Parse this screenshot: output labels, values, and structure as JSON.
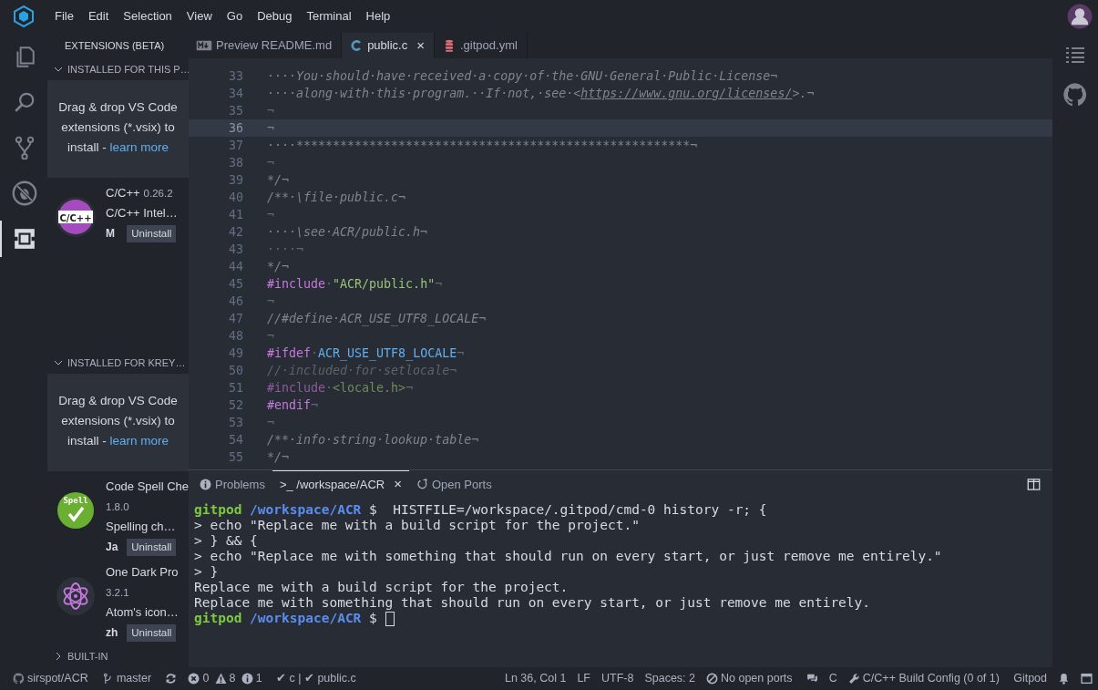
{
  "menu_bar": {
    "items": [
      "File",
      "Edit",
      "Selection",
      "View",
      "Go",
      "Debug",
      "Terminal",
      "Help"
    ]
  },
  "activity_bar": {
    "items": [
      {
        "kind": "files",
        "selected": false
      },
      {
        "kind": "search",
        "selected": false
      },
      {
        "kind": "scm",
        "selected": false
      },
      {
        "kind": "debug",
        "selected": false
      },
      {
        "kind": "extensions",
        "selected": true
      }
    ]
  },
  "sidebar": {
    "title": "EXTENSIONS (BETA)",
    "sections": [
      {
        "title": "INSTALLED FOR THIS P…",
        "expanded": true,
        "hint": {
          "text": "Drag & drop VS Code extensions (*.vsix) to install - ",
          "link": "learn more"
        },
        "extensions": [
          {
            "kind": "cpp",
            "icon_text": "C/C++",
            "name": "C/C++",
            "version": "0.26.2",
            "description": "C/C++ Intel…",
            "author": "M",
            "button": "Uninstall"
          }
        ]
      },
      {
        "title": "INSTALLED FOR KREY…",
        "expanded": true,
        "hint": {
          "text": "Drag & drop VS Code extensions (*.vsix) to install - ",
          "link": "learn more"
        },
        "extensions": [
          {
            "kind": "spell",
            "icon_text": "Spell",
            "name": "Code Spell Che",
            "version": "1.8.0",
            "description": "Spelling ch…",
            "author": "Ja",
            "button": "Uninstall"
          },
          {
            "kind": "atom",
            "name": "One Dark Pro",
            "version": "3.2.1",
            "description": "Atom's icon…",
            "author": "zh",
            "button": "Uninstall"
          }
        ]
      },
      {
        "title": "BUILT-IN",
        "expanded": false
      }
    ]
  },
  "editor_tabs": [
    {
      "kind": "markdown",
      "label": "Preview README.md",
      "selected": false
    },
    {
      "kind": "c",
      "label": "public.c",
      "selected": true,
      "close": "×"
    },
    {
      "kind": "yaml",
      "label": ".gitpod.yml",
      "selected": false
    }
  ],
  "editor": {
    "lines": [
      {
        "number": "33",
        "current": false,
        "tokens": [
          {
            "kind": "comment",
            "text": "····You·should·have·received·a·copy·of·the·GNU·General·Public·License¬"
          }
        ]
      },
      {
        "number": "34",
        "current": false,
        "tokens": [
          {
            "kind": "comment",
            "text": "····along·with·this·program.··If·not,·see·<"
          },
          {
            "kind": "link",
            "text": "https://www.gnu.org/licenses/"
          },
          {
            "kind": "comment",
            "text": ">.¬"
          }
        ]
      },
      {
        "number": "35",
        "current": false,
        "tokens": [
          {
            "kind": "ws",
            "text": "¬"
          }
        ]
      },
      {
        "number": "36",
        "current": true,
        "tokens": [
          {
            "kind": "ws",
            "text": "¬"
          }
        ]
      },
      {
        "number": "37",
        "current": false,
        "tokens": [
          {
            "kind": "comment",
            "text": "····******************************************************¬"
          }
        ]
      },
      {
        "number": "38",
        "current": false,
        "tokens": [
          {
            "kind": "ws",
            "text": "¬"
          }
        ]
      },
      {
        "number": "39",
        "current": false,
        "tokens": [
          {
            "kind": "comment",
            "text": "*/¬"
          }
        ]
      },
      {
        "number": "40",
        "current": false,
        "tokens": [
          {
            "kind": "comment",
            "text": "/**·\\file·public.c¬"
          }
        ]
      },
      {
        "number": "41",
        "current": false,
        "tokens": [
          {
            "kind": "ws",
            "text": "¬"
          }
        ]
      },
      {
        "number": "42",
        "current": false,
        "tokens": [
          {
            "kind": "comment",
            "text": "····\\see·ACR/public.h¬"
          }
        ]
      },
      {
        "number": "43",
        "current": false,
        "tokens": [
          {
            "kind": "ws",
            "text": "····¬"
          }
        ]
      },
      {
        "number": "44",
        "current": false,
        "tokens": [
          {
            "kind": "comment",
            "text": "*/¬"
          }
        ]
      },
      {
        "number": "45",
        "current": false,
        "tokens": [
          {
            "kind": "macro",
            "text": "#include"
          },
          {
            "kind": "ws",
            "text": "·"
          },
          {
            "kind": "string",
            "text": "\"ACR/public.h\""
          },
          {
            "kind": "ws",
            "text": "¬"
          }
        ]
      },
      {
        "number": "46",
        "current": false,
        "tokens": [
          {
            "kind": "ws",
            "text": "¬"
          }
        ]
      },
      {
        "number": "47",
        "current": false,
        "tokens": [
          {
            "kind": "comment",
            "text": "//#define·ACR_USE_UTF8_LOCALE¬"
          }
        ]
      },
      {
        "number": "48",
        "current": false,
        "tokens": [
          {
            "kind": "ws",
            "text": "¬"
          }
        ]
      },
      {
        "number": "49",
        "current": false,
        "tokens": [
          {
            "kind": "macro",
            "text": "#ifdef"
          },
          {
            "kind": "ws",
            "text": "·"
          },
          {
            "kind": "ident",
            "text": "ACR_USE_UTF8_LOCALE"
          },
          {
            "kind": "ws",
            "text": "¬"
          }
        ]
      },
      {
        "number": "50",
        "current": false,
        "tokens": [
          {
            "kind": "comment-inactive",
            "text": "//·included·for·setlocale¬"
          }
        ]
      },
      {
        "number": "51",
        "current": false,
        "tokens": [
          {
            "kind": "macro-inactive",
            "text": "#include"
          },
          {
            "kind": "ws",
            "text": "·"
          },
          {
            "kind": "string-inactive",
            "text": "<locale.h>"
          },
          {
            "kind": "ws",
            "text": "¬"
          }
        ]
      },
      {
        "number": "52",
        "current": false,
        "tokens": [
          {
            "kind": "macro",
            "text": "#endif"
          },
          {
            "kind": "ws",
            "text": "¬"
          }
        ]
      },
      {
        "number": "53",
        "current": false,
        "tokens": [
          {
            "kind": "ws",
            "text": "¬"
          }
        ]
      },
      {
        "number": "54",
        "current": false,
        "tokens": [
          {
            "kind": "comment",
            "text": "/**·info·string·lookup·table¬"
          }
        ]
      },
      {
        "number": "55",
        "current": false,
        "tokens": [
          {
            "kind": "comment",
            "text": "*/¬"
          }
        ]
      }
    ]
  },
  "panel": {
    "tabs": [
      {
        "kind": "info",
        "label": "Problems",
        "selected": false
      },
      {
        "kind": "terminal",
        "label": ">_ /workspace/ACR",
        "selected": true,
        "close": "×"
      },
      {
        "kind": "ports",
        "label": "Open Ports",
        "selected": false
      }
    ],
    "terminal": {
      "cursor": true,
      "lines": [
        {
          "segments": [
            {
              "kind": "user",
              "text": "gitpod"
            },
            {
              "kind": "path",
              "text": " /workspace/ACR"
            },
            {
              "kind": "plain",
              "text": " $  HISTFILE=/workspace/.gitpod/cmd-0 history -r; {"
            }
          ]
        },
        {
          "segments": [
            {
              "kind": "plain",
              "text": "> echo \"Replace me with a build script for the project.\""
            }
          ]
        },
        {
          "segments": [
            {
              "kind": "plain",
              "text": "> } && {"
            }
          ]
        },
        {
          "segments": [
            {
              "kind": "plain",
              "text": "> echo \"Replace me with something that should run on every start, or just remove me entirely.\""
            }
          ]
        },
        {
          "segments": [
            {
              "kind": "plain",
              "text": "> }"
            }
          ]
        },
        {
          "segments": [
            {
              "kind": "plain",
              "text": "Replace me with a build script for the project."
            }
          ]
        },
        {
          "segments": [
            {
              "kind": "plain",
              "text": "Replace me with something that should run on every start, or just remove me entirely."
            }
          ]
        },
        {
          "segments": [
            {
              "kind": "user",
              "text": "gitpod"
            },
            {
              "kind": "path",
              "text": " /workspace/ACR"
            },
            {
              "kind": "plain",
              "text": " $ "
            }
          ]
        }
      ]
    }
  },
  "status_bar": {
    "left": [
      {
        "parts": [
          {
            "kind": "github",
            "text": "sirspot/ACR"
          }
        ]
      },
      {
        "parts": [
          {
            "kind": "branch",
            "text": "master"
          }
        ]
      },
      {
        "parts": [
          {
            "kind": "sync"
          }
        ]
      },
      {
        "parts": [
          {
            "kind": "error",
            "text": "0"
          },
          {
            "kind": "warning",
            "text": "8"
          },
          {
            "kind": "info",
            "text": "1"
          }
        ]
      },
      {
        "parts": [
          {
            "text": "✔ c | ✔ public.c"
          }
        ]
      }
    ],
    "right": [
      {
        "parts": [
          {
            "text": "Ln 36, Col 1"
          }
        ]
      },
      {
        "parts": [
          {
            "text": "LF"
          }
        ]
      },
      {
        "parts": [
          {
            "text": "UTF-8"
          }
        ]
      },
      {
        "parts": [
          {
            "text": "Spaces: 2"
          }
        ]
      },
      {
        "parts": [
          {
            "kind": "ban",
            "text": "No open ports"
          }
        ]
      },
      {
        "parts": [
          {
            "kind": "chat"
          }
        ]
      },
      {
        "parts": [
          {
            "text": "C"
          }
        ]
      },
      {
        "parts": [
          {
            "kind": "wrench",
            "text": "C/C++ Build Config (0 of 1)"
          }
        ]
      },
      {
        "parts": [
          {
            "text": "Gitpod"
          }
        ]
      },
      {
        "parts": [
          {
            "kind": "bell"
          }
        ]
      },
      {
        "parts": [
          {
            "kind": "window"
          }
        ]
      }
    ]
  }
}
